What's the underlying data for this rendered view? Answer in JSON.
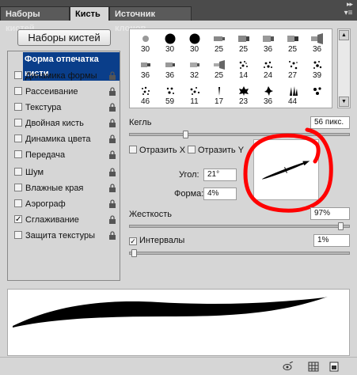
{
  "tabs": [
    {
      "label": "Наборы кистей",
      "active": false
    },
    {
      "label": "Кисть",
      "active": true
    },
    {
      "label": "Источник клонов",
      "active": false
    }
  ],
  "tab_close": "×",
  "presets_button": "Наборы кистей",
  "left_items": [
    {
      "label": "Форма отпечатка кисти",
      "checked": false,
      "selected": true,
      "lock": false
    },
    {
      "label": "Динамика формы",
      "checked": false,
      "selected": false,
      "lock": true
    },
    {
      "label": "Рассеивание",
      "checked": false,
      "selected": false,
      "lock": true
    },
    {
      "label": "Текстура",
      "checked": false,
      "selected": false,
      "lock": true
    },
    {
      "label": "Двойная кисть",
      "checked": false,
      "selected": false,
      "lock": true
    },
    {
      "label": "Динамика цвета",
      "checked": false,
      "selected": false,
      "lock": true
    },
    {
      "label": "Передача",
      "checked": false,
      "selected": false,
      "lock": true
    },
    {
      "label": "Шум",
      "checked": false,
      "selected": false,
      "lock": true
    },
    {
      "label": "Влажные края",
      "checked": false,
      "selected": false,
      "lock": true
    },
    {
      "label": "Аэрограф",
      "checked": false,
      "selected": false,
      "lock": true
    },
    {
      "label": "Сглаживание",
      "checked": true,
      "selected": false,
      "lock": true
    },
    {
      "label": "Защита текстуры",
      "checked": false,
      "selected": false,
      "lock": true
    }
  ],
  "brush_sizes": [
    "30",
    "30",
    "30",
    "25",
    "25",
    "36",
    "25",
    "36",
    "36",
    "36",
    "32",
    "25",
    "14",
    "24",
    "27",
    "39",
    "46",
    "59",
    "11",
    "17",
    "23",
    "36",
    "44"
  ],
  "size": {
    "label": "Кегль",
    "value": "56 пикс.",
    "slider": 0.25
  },
  "flip_x": {
    "label": "Отразить X",
    "checked": false
  },
  "flip_y": {
    "label": "Отразить Y",
    "checked": false
  },
  "angle": {
    "label": "Угол:",
    "value": "21°"
  },
  "roundness": {
    "label": "Форма:",
    "value": "4%"
  },
  "hardness": {
    "label": "Жесткость",
    "value": "97%",
    "slider": 0.97
  },
  "spacing": {
    "label": "Интервалы",
    "value": "1%",
    "checked": true,
    "slider": 0.01
  },
  "annotation_color": "#ff0000",
  "accent_selected": "#0a3e8a"
}
